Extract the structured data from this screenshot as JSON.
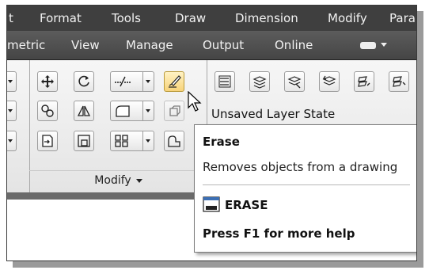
{
  "menubar": {
    "items": [
      "t",
      "Format",
      "Tools",
      "Draw",
      "Dimension",
      "Modify",
      "Para"
    ]
  },
  "tabs": {
    "items": [
      "metric",
      "View",
      "Manage",
      "Output",
      "Online"
    ]
  },
  "ribbon": {
    "panel_title": "Modify",
    "layer_state": "Unsaved Layer State"
  },
  "tooltip": {
    "title": "Erase",
    "description": "Removes objects from a drawing",
    "command": "ERASE",
    "help": "Press F1 for more help"
  },
  "colors": {
    "menubar_bg": "#3f3f3f",
    "ribbon_bg": "#ececec",
    "erase_highlight": "#f7d37a"
  }
}
